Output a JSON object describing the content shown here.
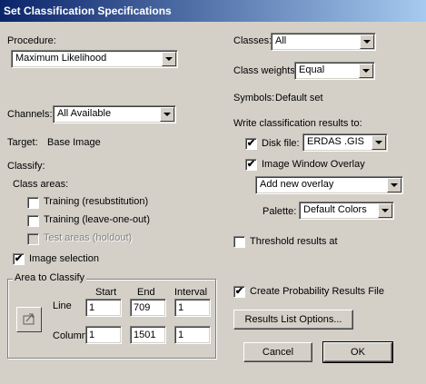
{
  "window": {
    "title": "Set Classification Specifications"
  },
  "procedure": {
    "label": "Procedure:",
    "value": "Maximum Likelihood"
  },
  "channels": {
    "label": "Channels:",
    "value": "All Available"
  },
  "target": {
    "label": "Target:",
    "value": "Base Image"
  },
  "classify": {
    "label": "Classify:",
    "class_areas_label": "Class areas:",
    "training_resub": {
      "label": "Training (resubstitution)",
      "checked": false
    },
    "training_loo": {
      "label": "Training (leave-one-out)",
      "checked": false
    },
    "test_areas": {
      "label": "Test areas (holdout)",
      "checked": false,
      "enabled": false
    },
    "image_selection": {
      "label": "Image selection",
      "checked": true,
      "mark": "✔"
    }
  },
  "area": {
    "title": "Area to Classify",
    "col_start": "Start",
    "col_end": "End",
    "col_interval": "Interval",
    "line_label": "Line",
    "column_label": "Column",
    "line_start": "1",
    "line_end": "709",
    "line_interval": "1",
    "col_start_val": "1",
    "col_end_val": "1501",
    "col_interval_val": "1"
  },
  "classes": {
    "label": "Classes:",
    "value": "All"
  },
  "class_weights": {
    "label": "Class weights:",
    "value": "Equal"
  },
  "symbols": {
    "label": "Symbols:",
    "value": "Default set"
  },
  "write_results": {
    "label": "Write classification results to:",
    "disk_file": {
      "label": "Disk file:",
      "checked": true,
      "mark": "✔",
      "value": "ERDAS .GIS"
    },
    "overlay": {
      "label": "Image Window Overlay",
      "checked": true,
      "mark": "✔"
    },
    "overlay_select": "Add new overlay",
    "palette": {
      "label": "Palette:",
      "value": "Default Colors"
    }
  },
  "threshold": {
    "label": "Threshold results at",
    "checked": false
  },
  "prob_file": {
    "label": "Create Probability Results File",
    "checked": true,
    "mark": "✔"
  },
  "buttons": {
    "results_list": "Results List Options...",
    "cancel": "Cancel",
    "ok": "OK"
  }
}
